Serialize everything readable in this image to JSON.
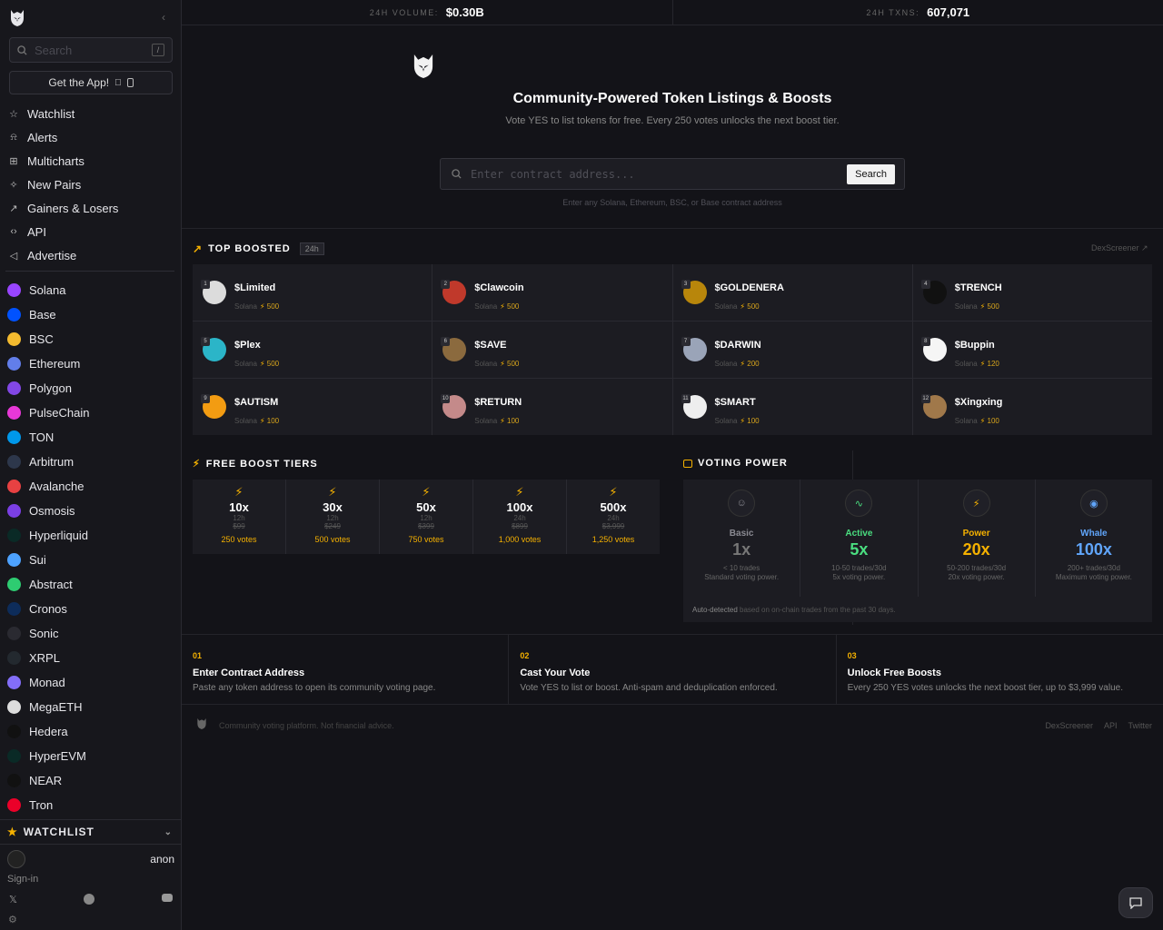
{
  "sidebar": {
    "search_placeholder": "Search",
    "search_shortcut": "/",
    "get_app": "Get the App!",
    "nav": [
      {
        "label": "Watchlist",
        "icon": "star-icon"
      },
      {
        "label": "Alerts",
        "icon": "bell-icon"
      },
      {
        "label": "Multicharts",
        "icon": "grid-icon"
      },
      {
        "label": "New Pairs",
        "icon": "sparkle-icon"
      },
      {
        "label": "Gainers & Losers",
        "icon": "arrow-up-right-icon"
      },
      {
        "label": "API",
        "icon": "code-icon"
      },
      {
        "label": "Advertise",
        "icon": "megaphone-icon"
      }
    ],
    "chains": [
      {
        "label": "Solana",
        "color": "#9945ff"
      },
      {
        "label": "Base",
        "color": "#0052ff"
      },
      {
        "label": "BSC",
        "color": "#f3ba2f"
      },
      {
        "label": "Ethereum",
        "color": "#627eea"
      },
      {
        "label": "Polygon",
        "color": "#8247e5"
      },
      {
        "label": "PulseChain",
        "color": "#e838d8"
      },
      {
        "label": "TON",
        "color": "#0098ea"
      },
      {
        "label": "Arbitrum",
        "color": "#2d374b"
      },
      {
        "label": "Avalanche",
        "color": "#e84142"
      },
      {
        "label": "Osmosis",
        "color": "#7b3fe4"
      },
      {
        "label": "Hyperliquid",
        "color": "#0a2a26"
      },
      {
        "label": "Sui",
        "color": "#4da2ff"
      },
      {
        "label": "Abstract",
        "color": "#2ecc71"
      },
      {
        "label": "Cronos",
        "color": "#0d2c5a"
      },
      {
        "label": "Sonic",
        "color": "#2a2a31"
      },
      {
        "label": "XRPL",
        "color": "#23292f"
      },
      {
        "label": "Monad",
        "color": "#836ef9"
      },
      {
        "label": "MegaETH",
        "color": "#dddddd"
      },
      {
        "label": "Hedera",
        "color": "#111111"
      },
      {
        "label": "HyperEVM",
        "color": "#0a2a26"
      },
      {
        "label": "NEAR",
        "color": "#111111"
      },
      {
        "label": "Tron",
        "color": "#eb0029"
      }
    ],
    "watchlist": "WATCHLIST",
    "user": "anon",
    "signin": "Sign-in"
  },
  "stats": {
    "volume_label": "24H VOLUME:",
    "volume_value": "$0.30B",
    "txns_label": "24H TXNS:",
    "txns_value": "607,071"
  },
  "hero": {
    "title": "Community-Powered Token Listings & Boosts",
    "subtitle": "Vote YES to list tokens for free. Every 250 votes unlocks the next boost tier.",
    "placeholder": "Enter contract address...",
    "search_button": "Search",
    "hint": "Enter any Solana, Ethereum, BSC, or Base contract address"
  },
  "top_boosted": {
    "title": "TOP BOOSTED",
    "badge": "24h",
    "link": "DexScreener",
    "items": [
      {
        "rank": "1",
        "name": "$Limited",
        "chain": "Solana",
        "points": "500",
        "color": "#dcdcdc"
      },
      {
        "rank": "2",
        "name": "$Clawcoin",
        "chain": "Solana",
        "points": "500",
        "color": "#c0392b"
      },
      {
        "rank": "3",
        "name": "$GOLDENERA",
        "chain": "Solana",
        "points": "500",
        "color": "#b8860b"
      },
      {
        "rank": "4",
        "name": "$TRENCH",
        "chain": "Solana",
        "points": "500",
        "color": "#111111"
      },
      {
        "rank": "5",
        "name": "$Plex",
        "chain": "Solana",
        "points": "500",
        "color": "#2bb5c8"
      },
      {
        "rank": "6",
        "name": "$SAVE",
        "chain": "Solana",
        "points": "500",
        "color": "#8b6a3e"
      },
      {
        "rank": "7",
        "name": "$DARWIN",
        "chain": "Solana",
        "points": "200",
        "color": "#9aa4b8"
      },
      {
        "rank": "8",
        "name": "$Buppin",
        "chain": "Solana",
        "points": "120",
        "color": "#f5f5f5"
      },
      {
        "rank": "9",
        "name": "$AUTISM",
        "chain": "Solana",
        "points": "100",
        "color": "#f39c12"
      },
      {
        "rank": "10",
        "name": "$RETURN",
        "chain": "Solana",
        "points": "100",
        "color": "#c48a8a"
      },
      {
        "rank": "11",
        "name": "$SMART",
        "chain": "Solana",
        "points": "100",
        "color": "#eeeeee"
      },
      {
        "rank": "12",
        "name": "$Xingxing",
        "chain": "Solana",
        "points": "100",
        "color": "#a0784a"
      }
    ]
  },
  "free_tiers": {
    "title": "FREE BOOST TIERS",
    "tiers": [
      {
        "mult": "10x",
        "dur": "12h",
        "old": "$99",
        "votes": "250 votes"
      },
      {
        "mult": "30x",
        "dur": "12h",
        "old": "$249",
        "votes": "500 votes"
      },
      {
        "mult": "50x",
        "dur": "12h",
        "old": "$399",
        "votes": "750 votes"
      },
      {
        "mult": "100x",
        "dur": "24h",
        "old": "$899",
        "votes": "1,000 votes"
      },
      {
        "mult": "500x",
        "dur": "24h",
        "old": "$3,999",
        "votes": "1,250 votes"
      }
    ]
  },
  "voting_power": {
    "title": "VOTING POWER",
    "levels": [
      {
        "name": "Basic",
        "mult": "1x",
        "d1": "< 10 trades",
        "d2": "Standard voting power.",
        "color": "#8a8a92"
      },
      {
        "name": "Active",
        "mult": "5x",
        "d1": "10-50 trades/30d",
        "d2": "5x voting power.",
        "color": "#4ade80"
      },
      {
        "name": "Power",
        "mult": "20x",
        "d1": "50-200 trades/30d",
        "d2": "20x voting power.",
        "color": "#f5b100"
      },
      {
        "name": "Whale",
        "mult": "100x",
        "d1": "200+ trades/30d",
        "d2": "Maximum voting power.",
        "color": "#60a5fa"
      }
    ],
    "foot_strong": "Auto-detected",
    "foot_rest": " based on on-chain trades from the past 30 days."
  },
  "steps": [
    {
      "num": "01",
      "title": "Enter Contract Address",
      "desc": "Paste any token address to open its community voting page."
    },
    {
      "num": "02",
      "title": "Cast Your Vote",
      "desc": "Vote YES to list or boost. Anti-spam and deduplication enforced."
    },
    {
      "num": "03",
      "title": "Unlock Free Boosts",
      "desc": "Every 250 YES votes unlocks the next boost tier, up to $3,999 value."
    }
  ],
  "footer": {
    "text": "Community voting platform. Not financial advice.",
    "links": [
      "DexScreener",
      "API",
      "Twitter"
    ]
  }
}
